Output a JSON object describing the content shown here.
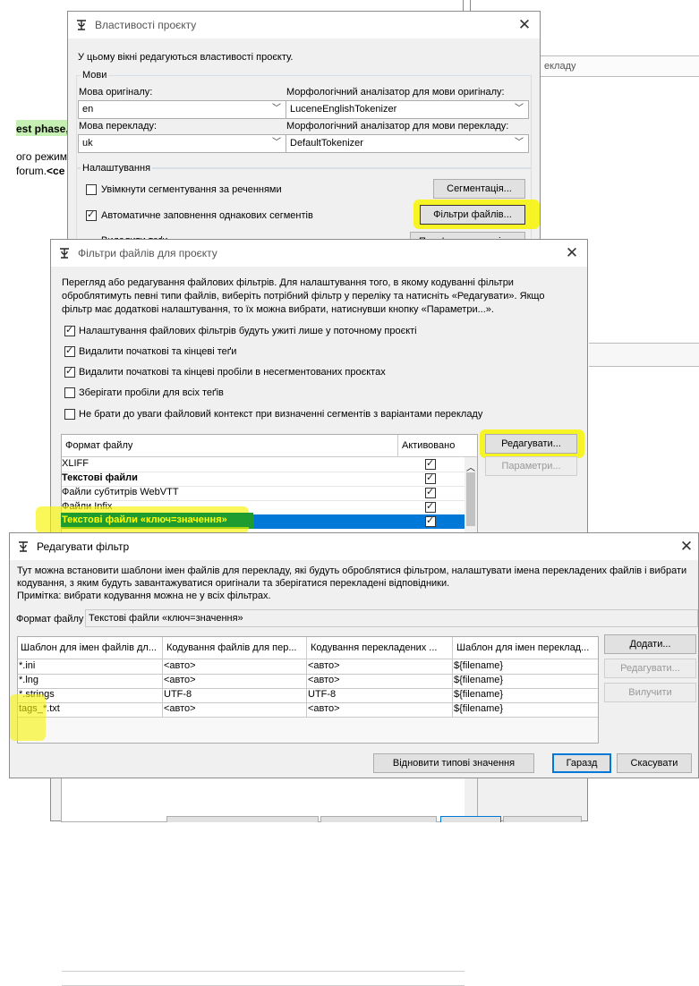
{
  "background": {
    "partial_text_1": "est phase,",
    "partial_text_2": "ого режиму",
    "partial_text_3": "forum.",
    "partial_text_4": "<ce",
    "right_label": "екладу"
  },
  "project_props": {
    "title": "Властивості проєкту",
    "description": "У цьому вікні редагуються властивості проєкту.",
    "languages_group": "Мови",
    "source_lang_label": "Мова оригіналу:",
    "source_lang_value": "en",
    "source_tokenizer_label": "Морфологічний аналізатор для мови оригіналу:",
    "source_tokenizer_value": "LuceneEnglishTokenizer",
    "target_lang_label": "Мова перекладу:",
    "target_lang_value": "uk",
    "target_tokenizer_label": "Морфологічний аналізатор для мови перекладу:",
    "target_tokenizer_value": "DefaultTokenizer",
    "settings_group": "Налаштування",
    "sentence_seg_label": "Увімкнути сегментування за реченнями",
    "sentence_seg_checked": false,
    "segmentation_button": "Сегментація...",
    "auto_fill_label": "Автоматичне заповнення однакових сегментів",
    "auto_fill_checked": true,
    "file_filters_button": "Фільтри файлів...",
    "partial_row_label": "Видалити теґи",
    "partial_row_button": "Прив'язки сценарію..."
  },
  "file_filters": {
    "title": "Фільтри файлів для проєкту",
    "description": "Перегляд або редагування файлових фільтрів. Для налаштування того, в якому кодуванні фільтри обробля́тимуть певні типи файлів, виберіть потрібний фільтр у переліку та натисніть «Редагувати». Якщо фільтр має додаткові налаштування, то їх можна вибрати, натиснувши кнопку «Параметри...».",
    "desc_line1": "Перегляд або редагування файлових фільтрів. Для налаштування того, в якому кодуванні фільтри",
    "desc_line2": "оброблятимуть певні типи файлів, виберіть потрібний фільтр у переліку та натисніть «Редагувати». Якщо",
    "desc_line3": "фільтр має додаткові налаштування, то їх можна вибрати, натиснувши кнопку «Параметри...».",
    "options": [
      {
        "label": "Налаштування файлових фільтрів будуть ужиті лише у поточному проєкті",
        "checked": true
      },
      {
        "label": "Видалити початкові та кінцеві теґи",
        "checked": true
      },
      {
        "label": "Видалити початкові та кінцеві пробіли в несегментованих проєктах",
        "checked": true
      },
      {
        "label": "Зберігати пробіли для всіх теґів",
        "checked": false
      },
      {
        "label": "Не брати до уваги файловий контекст при визначенні сегментів з варіантами перекладу",
        "checked": false
      }
    ],
    "col_format": "Формат файлу",
    "col_enabled": "Активовано",
    "rows": [
      {
        "name": "XLIFF",
        "bold": false,
        "enabled": true,
        "selected": false
      },
      {
        "name": "Текстові файли",
        "bold": true,
        "enabled": true,
        "selected": false
      },
      {
        "name": "Файли субтитрів WebVTT",
        "bold": false,
        "enabled": true,
        "selected": false
      },
      {
        "name": "Файли Infix",
        "bold": false,
        "enabled": true,
        "selected": false
      },
      {
        "name": "Текстові файли «ключ=значення»",
        "bold": true,
        "enabled": true,
        "selected": true
      }
    ],
    "edit_button": "Редагувати...",
    "params_button": "Параметри..."
  },
  "edit_filter": {
    "title": "Редагувати фільтр",
    "desc_line1": "Тут можна встановити шаблони імен файлів для перекладу, які будуть оброблятися фільтром, налаштувати імена перекладених файлів і вибрати",
    "desc_line2": "кодування, з яким будуть завантажуватися оригінали та зберігатися перекладені відповідники.",
    "desc_line3": "Примітка: вибрати кодування можна не у всіх фільтрах.",
    "format_label": "Формат файлу",
    "format_value": "Текстові файли «ключ=значення»",
    "columns": [
      "Шаблон для імен файлів дл...",
      "Кодування файлів для пер...",
      "Кодування перекладених ...",
      "Шаблон для імен переклад..."
    ],
    "rows": [
      [
        "*.ini",
        "<авто>",
        "<авто>",
        "${filename}"
      ],
      [
        "*.lng",
        "<авто>",
        "<авто>",
        "${filename}"
      ],
      [
        "*.strings",
        "UTF-8",
        "UTF-8",
        "${filename}"
      ],
      [
        "tags_*.txt",
        "<авто>",
        "<авто>",
        "${filename}"
      ]
    ],
    "add_button": "Додати...",
    "edit_button": "Редагувати...",
    "delete_button": "Вилучити",
    "reset_button": "Відновити типові значення",
    "ok_button": "Гаразд",
    "cancel_button": "Скасувати"
  },
  "colors": {
    "highlight": "#f7f400",
    "selection": "#0078d7",
    "selected_text": "#ffff00"
  }
}
